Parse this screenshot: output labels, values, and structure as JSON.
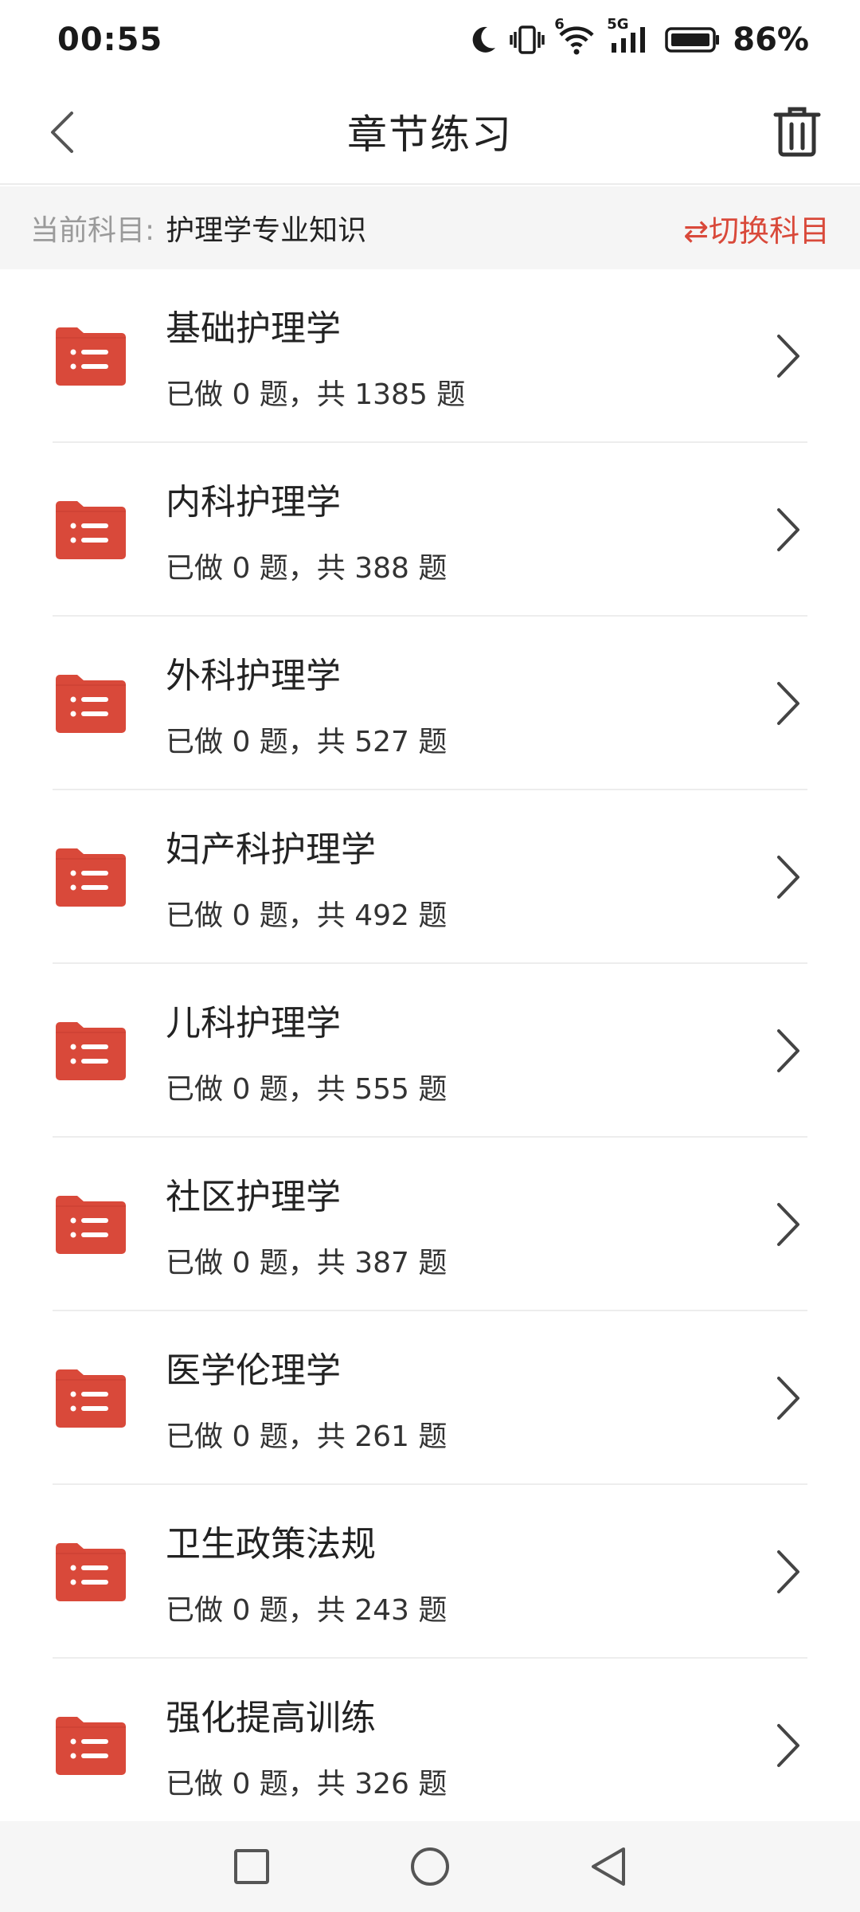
{
  "status_bar": {
    "time": "00:55",
    "network_label": "5G",
    "sim_label": "6",
    "battery_percent": "86%",
    "icons": [
      "moon-icon",
      "vibrate-icon",
      "wifi-icon",
      "signal-icon",
      "battery-icon"
    ]
  },
  "app_bar": {
    "title": "章节练习",
    "back_icon": "chevron-left-icon",
    "trash_icon": "trash-icon"
  },
  "subject": {
    "label": "当前科目:",
    "value": "护理学专业知识",
    "switch_label": "⇄切换科目"
  },
  "chapters": [
    {
      "title": "基础护理学",
      "progress": "已做 0 题，共 1385 题"
    },
    {
      "title": "内科护理学",
      "progress": "已做 0 题，共 388 题"
    },
    {
      "title": "外科护理学",
      "progress": "已做 0 题，共 527 题"
    },
    {
      "title": "妇产科护理学",
      "progress": "已做 0 题，共 492 题"
    },
    {
      "title": "儿科护理学",
      "progress": "已做 0 题，共 555 题"
    },
    {
      "title": "社区护理学",
      "progress": "已做 0 题，共 387 题"
    },
    {
      "title": "医学伦理学",
      "progress": "已做 0 题，共 261 题"
    },
    {
      "title": "卫生政策法规",
      "progress": "已做 0 题，共 243 题"
    },
    {
      "title": "强化提高训练",
      "progress": "已做 0 题，共 326 题"
    }
  ],
  "colors": {
    "accent": "#d9493a",
    "folder": "#d9493a"
  },
  "nav_bar": {
    "icons": [
      "recent-apps-icon",
      "home-icon",
      "back-icon"
    ]
  }
}
